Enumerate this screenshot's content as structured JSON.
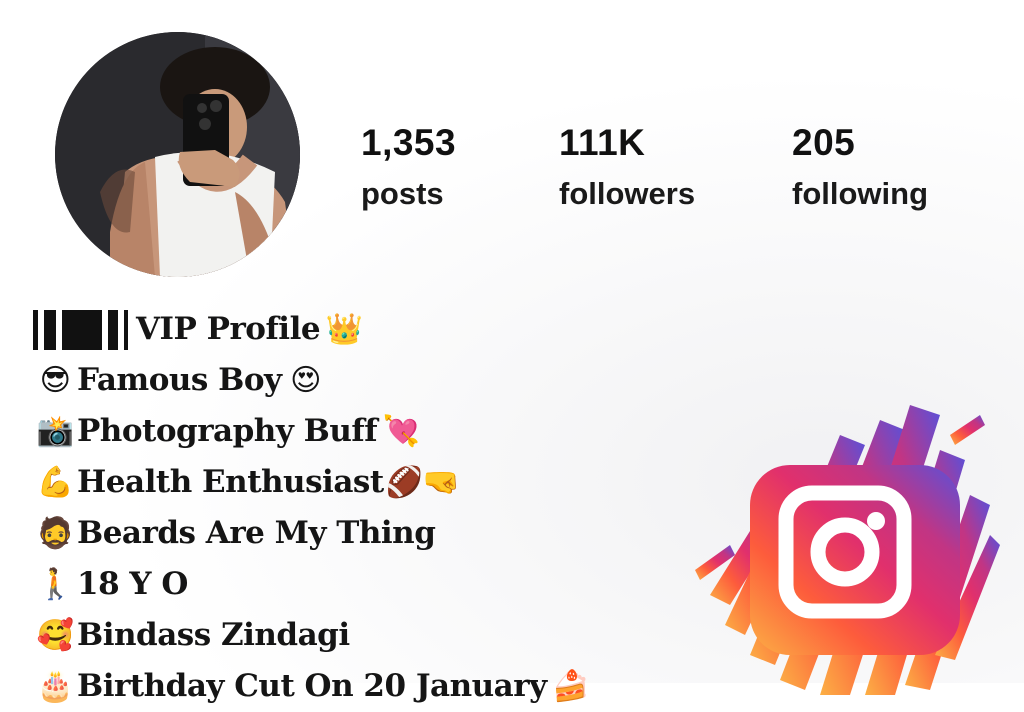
{
  "profile": {
    "stats": [
      {
        "value": "1,353",
        "label": "posts"
      },
      {
        "value": "111K",
        "label": "followers"
      },
      {
        "value": "205",
        "label": "following"
      }
    ]
  },
  "bio": {
    "lines": [
      {
        "prefix_emoji": "",
        "text": "VIP Profile",
        "suffix_emoji": "👑"
      },
      {
        "prefix_emoji": "😎",
        "text": "Famous Boy",
        "suffix_emoji": "😍"
      },
      {
        "prefix_emoji": "📸",
        "text": "Photography Buff",
        "suffix_emoji": "💘"
      },
      {
        "prefix_emoji": "💪",
        "text": "Health Enthusiast",
        "suffix_emoji": "🏈🤜"
      },
      {
        "prefix_emoji": "🧔",
        "text": "Beards Are My Thing",
        "suffix_emoji": ""
      },
      {
        "prefix_emoji": "🚶",
        "text": "18 Y O",
        "suffix_emoji": ""
      },
      {
        "prefix_emoji": "🥰",
        "text": "Bindass Zindagi",
        "suffix_emoji": ""
      },
      {
        "prefix_emoji": "🎂",
        "text": "Birthday Cut On 20 January",
        "suffix_emoji": "🍰"
      }
    ]
  },
  "icons": {
    "logo": "instagram-logo-icon"
  },
  "colors": {
    "logo_gradient": [
      "#fcb045",
      "#fd5c3c",
      "#e1306c",
      "#c13584",
      "#833ab4",
      "#5851db"
    ]
  }
}
